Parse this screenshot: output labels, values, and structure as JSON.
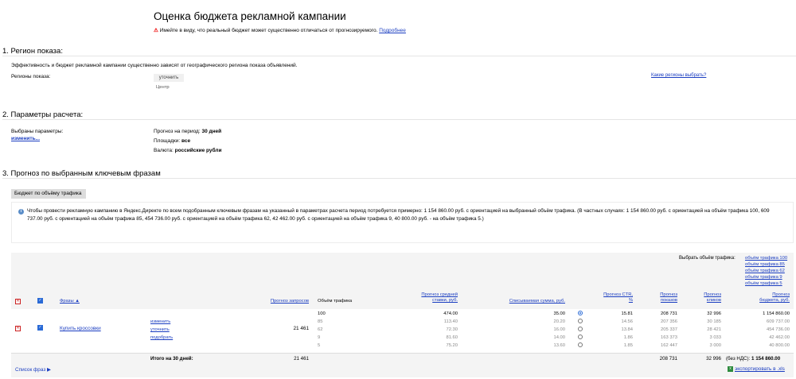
{
  "header": {
    "title": "Оценка бюджета рекламной кампании",
    "warning_text": "Имейте в виду, что реальный бюджет может существенно отличаться от прогнозируемого.",
    "warning_link": "Подробнее"
  },
  "region": {
    "section_title": "1. Регион показа:",
    "description": "Эффективность и бюджет рекламной кампании существенно зависят от географического региона показа объявлений.",
    "label": "Регионы показа:",
    "refine_button": "уточнить",
    "value": "Центр",
    "help_link": "Какие регионы выбрать?"
  },
  "params": {
    "section_title": "2. Параметры расчета:",
    "label": "Выбраны параметры:",
    "change_link": "изменить...",
    "period_label": "Прогноз на период:",
    "period_value": "30 дней",
    "sites_label": "Площадки:",
    "sites_value": "все",
    "currency_label": "Валюта:",
    "currency_value": "российские рубли"
  },
  "forecast": {
    "section_title": "3. Прогноз по выбранным ключевым фразам",
    "tab_label": "Бюджет по объёму трафика",
    "info_text": "Чтобы провести рекламную кампанию в Яндекс.Директе по всем подобранным ключевым фразам на указанный в параметрах расчета период потребуется примерно: 1 154 860.00 руб. с ориентацией на выбранный объём трафика. (В частных случаях: 1 154 860.00 руб. с ориентацией на объём трафика 100, 609 737.00 руб. с ориентацией на объём трафика 85, 454 736.00 руб. с ориентацией на объём трафика 62, 42 462.00 руб. с ориентацией на объём трафика 9, 40 800.00 руб. - на объём трафика 5.)"
  },
  "table": {
    "select_volume_label": "Выбрать объём трафика:",
    "volume_links": [
      "объём трафика 100",
      "объём трафика 85",
      "объём трафика 62",
      "объём трафика 9",
      "объём трафика 5"
    ],
    "headers": {
      "phrases": "Фразы ▲",
      "requests": "Прогноз запросов",
      "traffic": "Объём трафика",
      "bid": "Прогноз средней ставки, руб.",
      "charged": "Списываемая сумма, руб.",
      "ctr": "Прогноз CTR, %",
      "impressions": "Прогноз показов",
      "clicks": "Прогноз кликов",
      "budget": "Прогноз бюджета, руб."
    },
    "row": {
      "phrase": "Купить кроссовки",
      "actions": [
        "изменить",
        "уточнить",
        "подобрать"
      ],
      "requests": "21 461",
      "volumes": [
        {
          "traffic": "100",
          "bid": "474.00",
          "charged": "35.00",
          "ctr": "15.81",
          "impressions": "208 731",
          "clicks": "32 996",
          "budget": "1 154 860.00",
          "selected": true
        },
        {
          "traffic": "85",
          "bid": "113.40",
          "charged": "20.20",
          "ctr": "14.56",
          "impressions": "207 356",
          "clicks": "30 185",
          "budget": "609 737.00",
          "selected": false
        },
        {
          "traffic": "62",
          "bid": "72.30",
          "charged": "16.00",
          "ctr": "13.84",
          "impressions": "205 337",
          "clicks": "28 421",
          "budget": "454 736.00",
          "selected": false
        },
        {
          "traffic": "9",
          "bid": "81.60",
          "charged": "14.00",
          "ctr": "1.86",
          "impressions": "163 373",
          "clicks": "3 033",
          "budget": "42 462.00",
          "selected": false
        },
        {
          "traffic": "5",
          "bid": "75.20",
          "charged": "13.60",
          "ctr": "1.85",
          "impressions": "162 447",
          "clicks": "3 000",
          "budget": "40 800.00",
          "selected": false
        }
      ]
    },
    "totals": {
      "label": "Итого на 30 дней:",
      "requests": "21 461",
      "impressions": "208 731",
      "clicks": "32 996",
      "budget_prefix": "(без НДС):",
      "budget": "1 154 860.00"
    },
    "phrase_list_link": "Список фраз ▶",
    "export_link": "экспортировать в .xls"
  }
}
